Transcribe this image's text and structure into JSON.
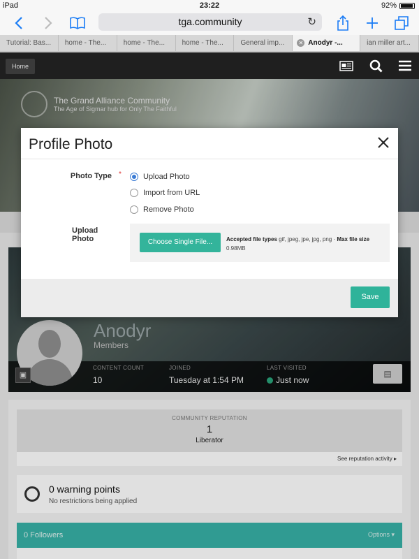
{
  "status_bar": {
    "device": "iPad",
    "time": "23:22",
    "battery": "92%"
  },
  "browser": {
    "url": "tga.community",
    "tabs": [
      {
        "label": "Tutorial: Bas..."
      },
      {
        "label": "home - The..."
      },
      {
        "label": "home - The..."
      },
      {
        "label": "home - The..."
      },
      {
        "label": "General imp..."
      },
      {
        "label": "Anodyr -..."
      },
      {
        "label": "ian miller art..."
      }
    ]
  },
  "site": {
    "home_label": "Home",
    "title": "The Grand Alliance Community",
    "subtitle": "The Age of Sigmar hub for Only The Faithful"
  },
  "profile": {
    "name": "Anodyr",
    "group": "Members",
    "stats": [
      {
        "label": "CONTENT COUNT",
        "value": "10"
      },
      {
        "label": "JOINED",
        "value": "Tuesday at 1:54 PM"
      },
      {
        "label": "LAST VISITED",
        "value": "Just now"
      }
    ],
    "online_color": "#2aa37a"
  },
  "reputation": {
    "label": "COMMUNITY REPUTATION",
    "value": "1",
    "rank": "Liberator",
    "see_activity": "See reputation activity ▸"
  },
  "warnings": {
    "title": "0 warning points",
    "subtitle": "No restrictions being applied"
  },
  "followers": {
    "title": "0 Followers",
    "options": "Options ▾"
  },
  "modal": {
    "title": "Profile Photo",
    "photo_type_label": "Photo Type",
    "required_mark": "*",
    "options": [
      {
        "label": "Upload Photo",
        "selected": true
      },
      {
        "label": "Import from URL",
        "selected": false
      },
      {
        "label": "Remove Photo",
        "selected": false
      }
    ],
    "upload_label": "Upload Photo",
    "choose_button": "Choose Single File...",
    "accepted_types_label": "Accepted file types",
    "accepted_types": "gif, jpeg, jpe, jpg, png",
    "separator": "·",
    "max_size_label": "Max file size",
    "max_size": "0.98MB",
    "save_button": "Save"
  },
  "colors": {
    "accent": "#33b49b",
    "followers_bar": "#37b1a7",
    "ios_blue": "#1a7cf5"
  }
}
